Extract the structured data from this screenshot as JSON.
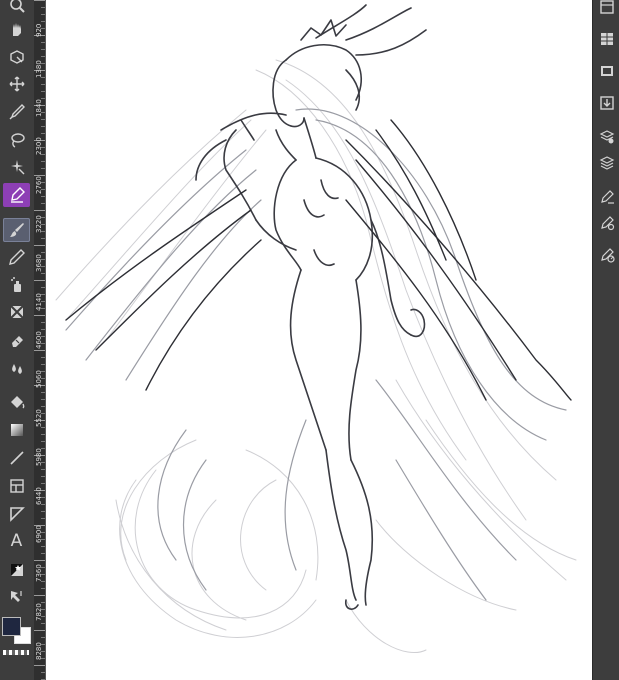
{
  "app": {
    "canvas_background": "#ffffff",
    "panel_color": "#3d3d3d",
    "ruler_color": "#2f2f2f",
    "accent_active": "#5a5f70",
    "vector_pen_color": "#8d3fb5"
  },
  "left_toolbar": {
    "tools": [
      {
        "name": "zoom",
        "icon": "magnifier-icon"
      },
      {
        "name": "pan",
        "icon": "hand-icon"
      },
      {
        "name": "transform",
        "icon": "transform-icon"
      },
      {
        "name": "move",
        "icon": "move-icon"
      },
      {
        "name": "eyedropper",
        "icon": "eyedropper-icon"
      },
      {
        "name": "lasso",
        "icon": "lasso-icon"
      },
      {
        "name": "magic-wand",
        "icon": "magic-wand-icon"
      },
      {
        "name": "vector-pen",
        "icon": "vector-pen-icon"
      },
      {
        "name": "brush",
        "icon": "brush-icon",
        "active": true
      },
      {
        "name": "pencil",
        "icon": "pencil-icon"
      },
      {
        "name": "airbrush",
        "icon": "airbrush-icon"
      },
      {
        "name": "blend",
        "icon": "blend-icon"
      },
      {
        "name": "eraser",
        "icon": "eraser-icon"
      },
      {
        "name": "smudge",
        "icon": "droplets-icon"
      },
      {
        "name": "fill",
        "icon": "paint-bucket-icon"
      },
      {
        "name": "gradient",
        "icon": "gradient-icon"
      },
      {
        "name": "line",
        "icon": "line-icon"
      },
      {
        "name": "frame",
        "icon": "frame-icon"
      },
      {
        "name": "shape",
        "icon": "shape-icon"
      },
      {
        "name": "text",
        "icon": "text-icon"
      },
      {
        "name": "color-adjust",
        "icon": "color-adjust-icon"
      },
      {
        "name": "selection-arrow",
        "icon": "arrow-select-icon"
      }
    ],
    "text_tool_glyph": "A",
    "primary_color": "#1f2740",
    "secondary_color": "#ffffff"
  },
  "ruler": {
    "labels": [
      "920",
      "1380",
      "1840",
      "2300",
      "2760",
      "3220",
      "3680",
      "4140",
      "4600",
      "5060",
      "5520",
      "5980",
      "6440",
      "6900",
      "7360",
      "7820",
      "8280"
    ]
  },
  "right_toolbar": {
    "tools": [
      {
        "name": "brush-library",
        "icon": "brush-library-icon"
      },
      {
        "name": "layers-grid",
        "icon": "grid-panel-icon"
      },
      {
        "name": "film",
        "icon": "film-icon"
      },
      {
        "name": "import",
        "icon": "import-icon"
      },
      {
        "name": "layer-settings",
        "icon": "layer-settings-icon"
      },
      {
        "name": "layers",
        "icon": "layers-icon"
      },
      {
        "name": "pen-settings",
        "icon": "pen-settings-icon"
      },
      {
        "name": "pen-gear",
        "icon": "pen-gear-icon"
      },
      {
        "name": "pen-dial",
        "icon": "pen-dial-icon"
      }
    ]
  }
}
